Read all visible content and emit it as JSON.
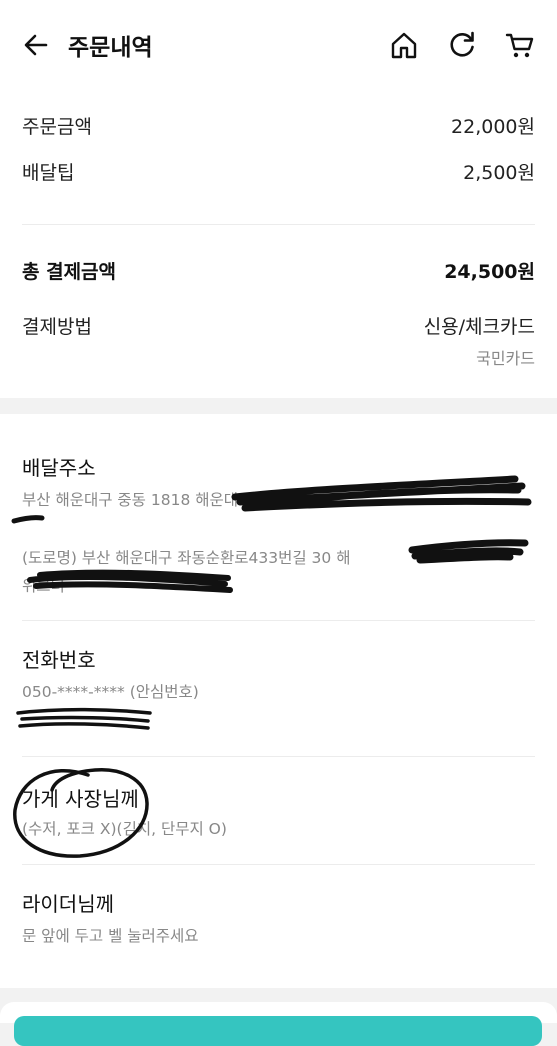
{
  "header": {
    "title": "주문내역",
    "icons": [
      "back-arrow-icon",
      "home-icon",
      "refresh-icon",
      "cart-icon"
    ]
  },
  "summary": {
    "order_amount_label": "주문금액",
    "order_amount_value": "22,000원",
    "delivery_tip_label": "배달팁",
    "delivery_tip_value": "2,500원",
    "total_label": "총 결제금액",
    "total_value": "24,500원",
    "payment_method_label": "결제방법",
    "payment_method_value": "신용/체크카드",
    "card_name": "국민카드"
  },
  "delivery": {
    "address_title": "배달주소",
    "address_line1": "부산 해운대구 중동 1818 해운대",
    "address_line2": "(도로명) 부산 해운대구 좌동순환로433번길 30 해",
    "address_line3": "위브더"
  },
  "phone": {
    "title": "전화번호",
    "safe_number": "050-****-**** (안심번호)"
  },
  "store_request": {
    "title": "가게 사장님께",
    "text": "(수저, 포크 X)(김치, 단무지 O)"
  },
  "rider_request": {
    "title": "라이더님께",
    "text": "문 앞에 두고 벨 눌러주세요"
  },
  "colors": {
    "accent": "#35c5c0",
    "background": "#f2f2f2",
    "text_secondary": "#888888"
  }
}
